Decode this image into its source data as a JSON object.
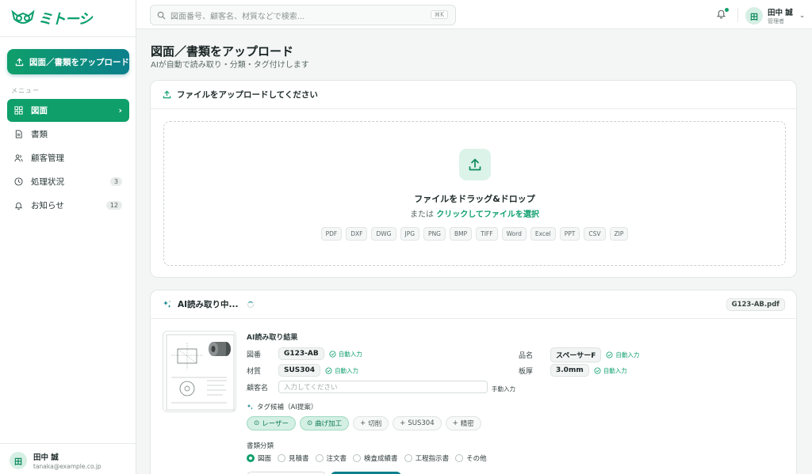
{
  "app": {
    "logo_text": "ミトーシ"
  },
  "sidebar": {
    "upload_label": "図面／書類をアップロード",
    "menu_label": "メニュー",
    "items": [
      {
        "label": "図面",
        "icon": "grid-icon",
        "active": true,
        "badge": ""
      },
      {
        "label": "書類",
        "icon": "document-icon",
        "active": false,
        "badge": ""
      },
      {
        "label": "顧客管理",
        "icon": "users-icon",
        "active": false,
        "badge": ""
      },
      {
        "label": "処理状況",
        "icon": "clock-icon",
        "active": false,
        "badge": "3"
      },
      {
        "label": "お知らせ",
        "icon": "bell-icon",
        "active": false,
        "badge": "12"
      }
    ],
    "user": {
      "avatar": "田",
      "name": "田中 誠",
      "email": "tanaka@example.co.jp"
    }
  },
  "topbar": {
    "search_placeholder": "図面番号、顧客名、材質などで検索...",
    "shortcut": "⌘K",
    "user": {
      "avatar": "田",
      "name": "田中 誠",
      "role": "管理者"
    }
  },
  "page": {
    "title": "図面／書類をアップロード",
    "subtitle": "AIが自動で読み取り・分類・タグ付けします"
  },
  "upload": {
    "header": "ファイルをアップロードしてください",
    "title": "ファイルをドラッグ&ドロップ",
    "sub_prefix": "または ",
    "sub_link": "クリックしてファイルを選択",
    "formats": [
      "PDF",
      "DXF",
      "DWG",
      "JPG",
      "PNG",
      "BMP",
      "TIFF",
      "Word",
      "Excel",
      "PPT",
      "CSV",
      "ZIP"
    ]
  },
  "processing": {
    "header": "AI読み取り中...",
    "file_name": "G123-AB.pdf",
    "result_title": "AI読み取り結果",
    "fields": {
      "drawing_no": {
        "label": "図番",
        "value": "G123-AB",
        "status": "自動入力"
      },
      "material": {
        "label": "材質",
        "value": "SUS304",
        "status": "自動入力"
      },
      "product": {
        "label": "品名",
        "value": "スペーサーF",
        "status": "自動入力"
      },
      "thickness": {
        "label": "板厚",
        "value": "3.0mm",
        "status": "自動入力"
      },
      "customer": {
        "label": "顧客名",
        "placeholder": "入力してください",
        "status": "手動入力"
      }
    },
    "tag_title": "タグ候補（AI提案）",
    "tags": [
      {
        "label": "レーザー",
        "selected": true
      },
      {
        "label": "曲げ加工",
        "selected": true
      },
      {
        "label": "切削",
        "selected": false
      },
      {
        "label": "SUS304",
        "selected": false
      },
      {
        "label": "精密",
        "selected": false
      }
    ],
    "doc_type_title": "書類分類",
    "doc_types": [
      {
        "label": "図面",
        "selected": true
      },
      {
        "label": "見積書",
        "selected": false
      },
      {
        "label": "注文書",
        "selected": false
      },
      {
        "label": "検査成績書",
        "selected": false
      },
      {
        "label": "工程指示書",
        "selected": false
      },
      {
        "label": "その他",
        "selected": false
      }
    ]
  },
  "colors": {
    "accent": "#0f9f6a",
    "accent2": "#0c7f8c"
  }
}
